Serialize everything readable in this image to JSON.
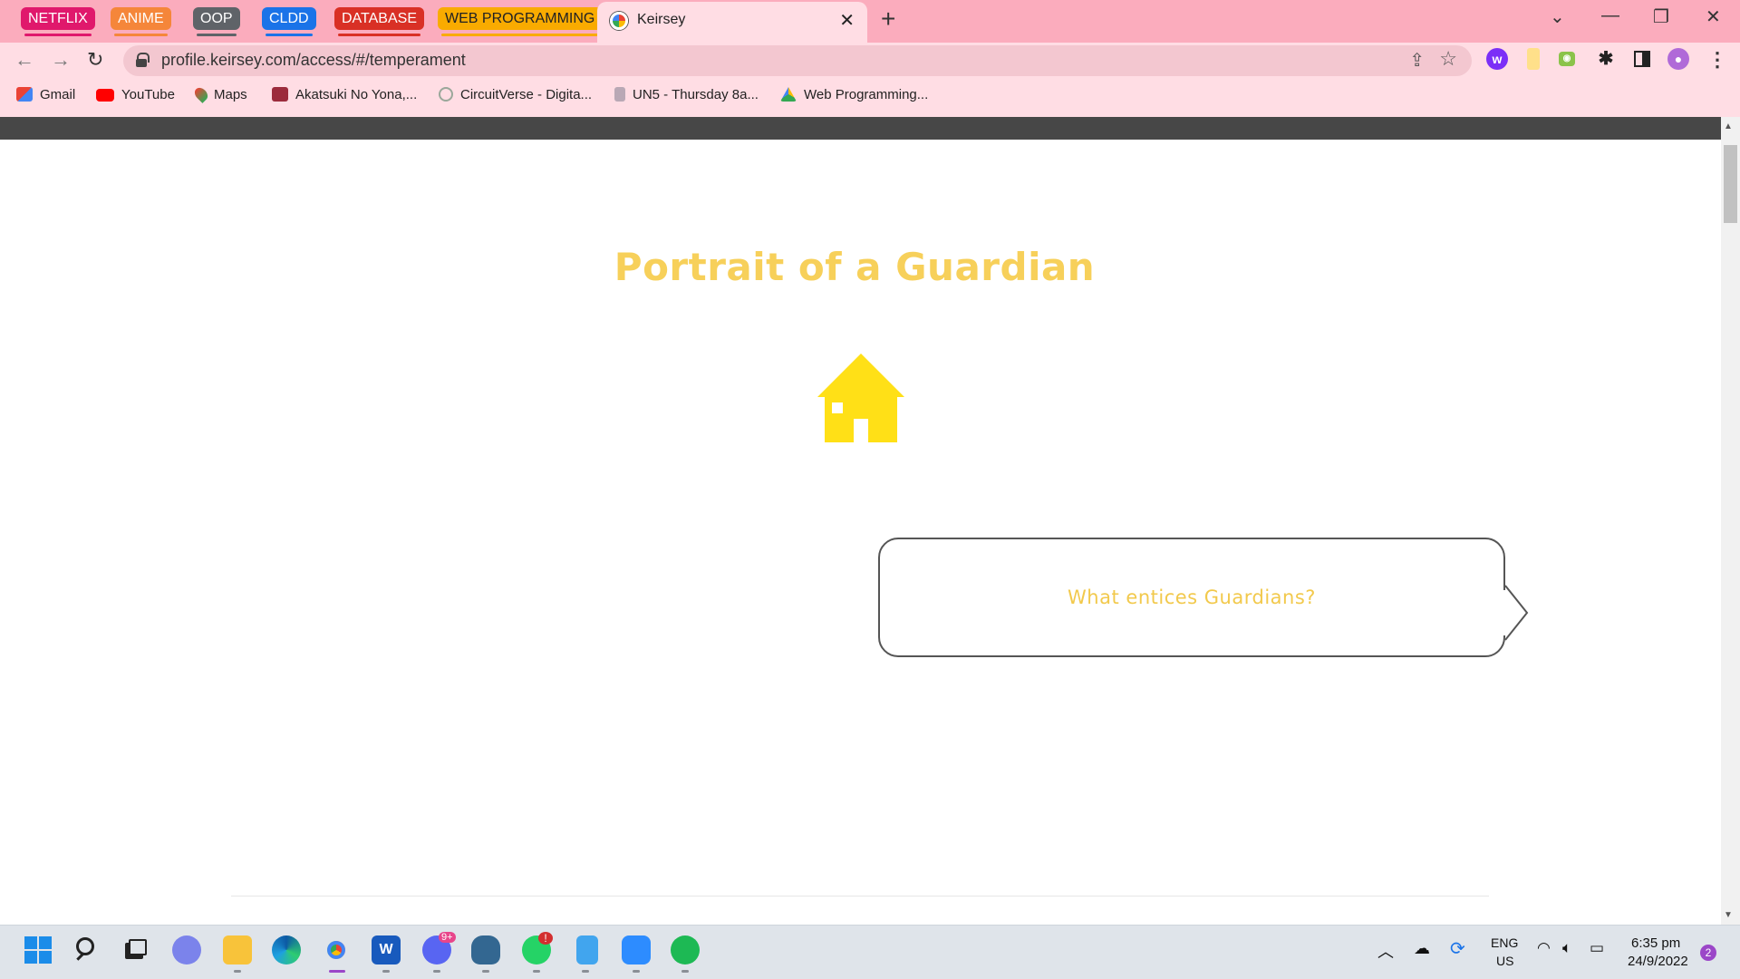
{
  "browser": {
    "tab_groups": [
      {
        "label": "NETFLIX",
        "color": "#e0186c",
        "text_color": "#ffffff"
      },
      {
        "label": "ANIME",
        "color": "#f5863a",
        "text_color": "#ffffff"
      },
      {
        "label": "OOP",
        "color": "#5f6368",
        "text_color": "#ffffff"
      },
      {
        "label": "CLDD",
        "color": "#1a73e8",
        "text_color": "#ffffff"
      },
      {
        "label": "DATABASE",
        "color": "#d93025",
        "text_color": "#ffffff"
      },
      {
        "label": "WEB PROGRAMMING",
        "color": "#f9ab00",
        "text_color": "#202124"
      }
    ],
    "active_tab": {
      "title": "Keirsey",
      "close": "✕"
    },
    "new_tab": "+",
    "window_controls": {
      "dropdown": "⌄",
      "minimize": "—",
      "restore": "❐",
      "close": "✕"
    },
    "toolbar": {
      "back": "←",
      "forward": "→",
      "reload": "↻",
      "menu": "⋮"
    },
    "url": "profile.keirsey.com/access/#/temperament",
    "bookmarks": [
      {
        "label": "Gmail"
      },
      {
        "label": "YouTube"
      },
      {
        "label": "Maps"
      },
      {
        "label": "Akatsuki No Yona,..."
      },
      {
        "label": "CircuitVerse - Digita..."
      },
      {
        "label": "UN5 - Thursday 8a..."
      },
      {
        "label": "Web Programming..."
      }
    ]
  },
  "page": {
    "heading": "Portrait of a Guardian",
    "bubble_text": "What entices Guardians?",
    "accent_color": "#f7d05a",
    "icon": "house-icon"
  },
  "taskbar": {
    "apps": [
      "start",
      "search",
      "task-view",
      "teams-chat",
      "file-explorer",
      "edge",
      "chrome",
      "word",
      "discord",
      "postgresql",
      "whatsapp",
      "notepad",
      "zoom",
      "spotify"
    ],
    "badges": {
      "discord": "9+",
      "whatsapp": "!"
    },
    "tray": {
      "lang_top": "ENG",
      "lang_bottom": "US",
      "time": "6:35 pm",
      "date": "24/9/2022",
      "notification_count": "2"
    }
  }
}
